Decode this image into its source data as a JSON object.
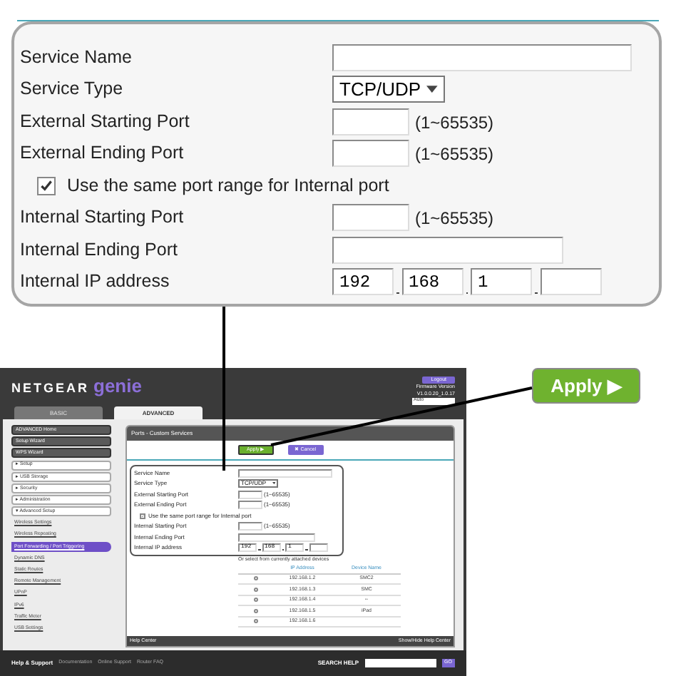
{
  "form": {
    "rows": [
      {
        "kind": "text",
        "label": "Service Name"
      },
      {
        "kind": "select",
        "label": "Service Type",
        "value": "TCP/UDP"
      },
      {
        "kind": "port",
        "label": "External Starting Port",
        "hint": "(1~65535)"
      },
      {
        "kind": "port",
        "label": "External Ending Port",
        "hint": "(1~65535)"
      },
      {
        "kind": "checkbox",
        "label": "Use the same port range for Internal port",
        "checked": true
      },
      {
        "kind": "port",
        "label": "Internal Starting Port",
        "hint": "(1~65535)"
      },
      {
        "kind": "text",
        "label": "Internal Ending Port"
      },
      {
        "kind": "ip",
        "label": "Internal IP address",
        "octets": [
          "192",
          "168",
          "1"
        ]
      }
    ]
  },
  "router_page": {
    "logo": {
      "brand": "NETGEAR",
      "product": "genie"
    },
    "logout": "Logout",
    "firmware": [
      "Firmware Version",
      "V1.0.0.20_1.0.17"
    ],
    "language": "Auto",
    "tabs": [
      {
        "label": "BASIC",
        "selected": false
      },
      {
        "label": "ADVANCED",
        "selected": true
      }
    ],
    "sidebar": [
      {
        "kind": "button",
        "label": "ADVANCED Home",
        "selected": false
      },
      {
        "kind": "button",
        "label": "Setup Wizard",
        "selected": false
      },
      {
        "kind": "button",
        "label": "WPS Wizard",
        "selected": false
      },
      {
        "kind": "section",
        "label": "▸ Setup",
        "selected": false
      },
      {
        "kind": "section",
        "label": "▸ USB Storage",
        "selected": false
      },
      {
        "kind": "section",
        "label": "▸ Security",
        "selected": false
      },
      {
        "kind": "section",
        "label": "▸ Administration",
        "selected": false
      },
      {
        "kind": "section",
        "label": "▾ Advanced Setup",
        "selected": false
      },
      {
        "kind": "link",
        "label": "Wireless Settings",
        "selected": false
      },
      {
        "kind": "link",
        "label": "Wireless Repeating",
        "selected": false
      },
      {
        "kind": "link",
        "label": "Port Forwarding / Port Triggering",
        "selected": true
      },
      {
        "kind": "link",
        "label": "Dynamic DNS",
        "selected": false
      },
      {
        "kind": "link",
        "label": "Static Routes",
        "selected": false
      },
      {
        "kind": "link",
        "label": "Remote Management",
        "selected": false
      },
      {
        "kind": "link",
        "label": "UPnP",
        "selected": false
      },
      {
        "kind": "link",
        "label": "IPv6",
        "selected": false
      },
      {
        "kind": "link",
        "label": "Traffic Meter",
        "selected": false
      },
      {
        "kind": "link",
        "label": "USB Settings",
        "selected": false
      }
    ],
    "panel_title": "Ports - Custom Services",
    "buttons": [
      {
        "kind": "apply",
        "label": "Apply ▶"
      },
      {
        "kind": "cancel",
        "label": "✖ Cancel"
      }
    ],
    "form": {
      "rows": [
        {
          "kind": "text",
          "label": "Service Name"
        },
        {
          "kind": "select",
          "label": "Service Type",
          "value": "TCP/UDP"
        },
        {
          "kind": "port",
          "label": "External Starting Port",
          "hint": "(1~65535)"
        },
        {
          "kind": "port",
          "label": "External Ending Port",
          "hint": "(1~65535)"
        },
        {
          "kind": "checkbox",
          "label": "Use the same port range for Internal port",
          "checked": true
        },
        {
          "kind": "port",
          "label": "Internal Starting Port",
          "hint": "(1~65535)"
        },
        {
          "kind": "text",
          "label": "Internal Ending Port"
        },
        {
          "kind": "ip",
          "label": "Internal IP address",
          "octets": [
            "192",
            "168",
            "1"
          ]
        }
      ]
    },
    "table": {
      "caption": "Or select from currently attached devices",
      "columns": [
        "IP Address",
        "Device Name"
      ],
      "rows": [
        {
          "selected": false,
          "ip": "192.168.1.2",
          "device": "SMC2"
        },
        {
          "selected": false,
          "ip": "192.168.1.3",
          "device": "SMC"
        },
        {
          "selected": false,
          "ip": "192.168.1.4",
          "device": "--"
        },
        {
          "selected": false,
          "ip": "192.168.1.5",
          "device": "iPad"
        },
        {
          "selected": false,
          "ip": "192.168.1.6"
        }
      ]
    },
    "help_center": "Help Center",
    "show_hide": "Show/Hide Help Center",
    "footer": {
      "help": "Help & Support",
      "links": [
        "Documentation",
        "Online Support",
        "Router FAQ"
      ],
      "search_label": "SEARCH HELP",
      "go": "GO"
    }
  },
  "callout_button": "Apply ▶"
}
